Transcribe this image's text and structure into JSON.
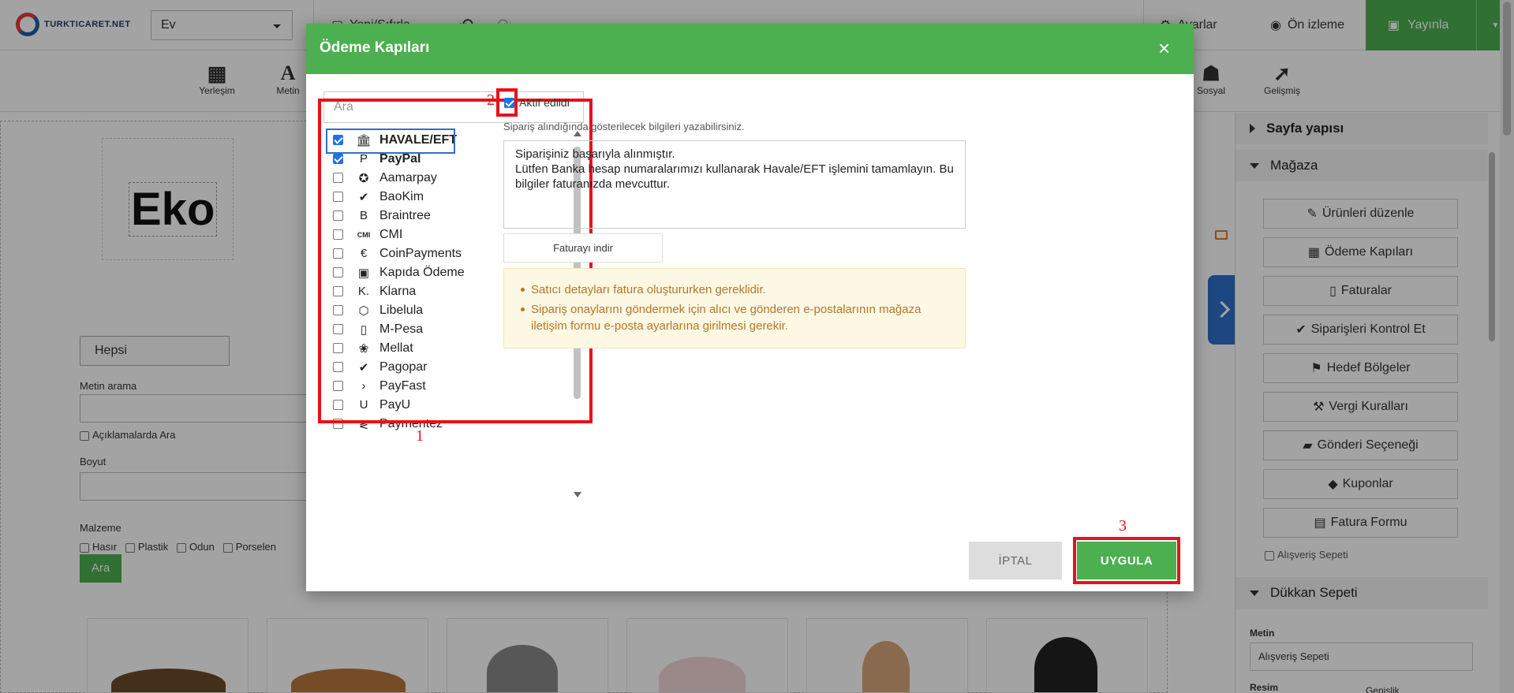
{
  "app": {
    "logo_text": "TURKTICARET.NET",
    "page_select": "Ev",
    "new_reset": "Yeni/Sıfırla",
    "settings": "Ayarlar",
    "preview": "Ön izleme",
    "publish": "Yayınla"
  },
  "toolbar": {
    "items": [
      {
        "label": "Yerleşim",
        "icon": "layout-icon"
      },
      {
        "label": "Metin",
        "icon": "text-icon"
      },
      {
        "label": "Sosyal",
        "icon": "users-icon"
      },
      {
        "label": "Gelişmiş",
        "icon": "rocket-icon"
      }
    ]
  },
  "canvas": {
    "logo_text": "Eko",
    "filter": {
      "category": "Hepsi",
      "text_search_label": "Metin arama",
      "search_in_desc": "Açıklamalarda Ara",
      "size_label": "Boyut",
      "material_label": "Malzeme",
      "materials": [
        "Hasır",
        "Plastik",
        "Odun",
        "Porselen"
      ],
      "search_button": "Ara"
    }
  },
  "right_panel": {
    "page_structure": "Sayfa yapısı",
    "store": "Mağaza",
    "store_buttons": [
      {
        "label": "Ürünleri düzenle",
        "icon": "pencil-icon"
      },
      {
        "label": "Ödeme Kapıları",
        "icon": "grid-icon"
      },
      {
        "label": "Faturalar",
        "icon": "file-icon"
      },
      {
        "label": "Siparişleri Kontrol Et",
        "icon": "check-icon"
      },
      {
        "label": "Hedef Bölgeler",
        "icon": "signpost-icon"
      },
      {
        "label": "Vergi Kuralları",
        "icon": "gavel-icon"
      },
      {
        "label": "Gönderi Seçeneği",
        "icon": "truck-icon"
      },
      {
        "label": "Kuponlar",
        "icon": "tags-icon"
      },
      {
        "label": "Fatura Formu",
        "icon": "form-icon"
      }
    ],
    "cart_check": "Alışveriş Sepeti",
    "shop_cart": "Dükkan Sepeti",
    "text_label": "Metin",
    "text_value": "Alışveriş Sepeti",
    "image_label": "Resim",
    "width_label": "Genişlik"
  },
  "modal": {
    "title": "Ödeme Kapıları",
    "search_placeholder": "Ara",
    "gateways": [
      {
        "name": "HAVALE/EFT",
        "checked": true,
        "icon": "bank-icon",
        "glyph": "🏛"
      },
      {
        "name": "PayPal",
        "checked": true,
        "icon": "paypal-icon",
        "glyph": "P"
      },
      {
        "name": "Aamarpay",
        "checked": false,
        "icon": "aamarpay-icon",
        "glyph": "✪"
      },
      {
        "name": "BaoKim",
        "checked": false,
        "icon": "baokim-icon",
        "glyph": "✔"
      },
      {
        "name": "Braintree",
        "checked": false,
        "icon": "braintree-icon",
        "glyph": "B"
      },
      {
        "name": "CMI",
        "checked": false,
        "icon": "cmi-icon",
        "glyph": "CMI"
      },
      {
        "name": "CoinPayments",
        "checked": false,
        "icon": "coinpayments-icon",
        "glyph": "€"
      },
      {
        "name": "Kapıda Ödeme",
        "checked": false,
        "icon": "cash-icon",
        "glyph": "▣"
      },
      {
        "name": "Klarna",
        "checked": false,
        "icon": "klarna-icon",
        "glyph": "K."
      },
      {
        "name": "Libelula",
        "checked": false,
        "icon": "libelula-icon",
        "glyph": "⬡"
      },
      {
        "name": "M-Pesa",
        "checked": false,
        "icon": "mpesa-icon",
        "glyph": "▯"
      },
      {
        "name": "Mellat",
        "checked": false,
        "icon": "mellat-icon",
        "glyph": "❀"
      },
      {
        "name": "Pagopar",
        "checked": false,
        "icon": "pagopar-icon",
        "glyph": "✔"
      },
      {
        "name": "PayFast",
        "checked": false,
        "icon": "payfast-icon",
        "glyph": "›"
      },
      {
        "name": "PayU",
        "checked": false,
        "icon": "payu-icon",
        "glyph": "U"
      },
      {
        "name": "Paymentez",
        "checked": false,
        "icon": "paymentez-icon",
        "glyph": "≷"
      }
    ],
    "active_label": "Aktif edildi",
    "info_hint": "Sipariş alındığında gösterilecek bilgileri yazabilirsiniz.",
    "message_lines": [
      "Siparişiniz başarıyla alınmıştır.",
      "Lütfen Banka hesap numaralarımızı kullanarak Havale/EFT işlemini tamamlayın. Bu bilgiler faturanızda mevcuttur."
    ],
    "invoice_button": "Faturayı indir",
    "warnings": [
      "Satıcı detayları fatura oluştururken gereklidir.",
      "Sipariş onaylarını göndermek için alıcı ve gönderen e-postalarının mağaza iletişim formu e-posta ayarlarına girilmesi gerekir."
    ],
    "cancel": "İPTAL",
    "apply": "UYGULA"
  },
  "annotations": {
    "one": "1",
    "two": "2",
    "three": "3",
    "color": "#e8111a"
  },
  "colors": {
    "brand_green": "#4caf50",
    "accent_blue": "#2e6fc9",
    "warning_text": "#b5762a",
    "warning_bg": "#fcf8e3"
  }
}
